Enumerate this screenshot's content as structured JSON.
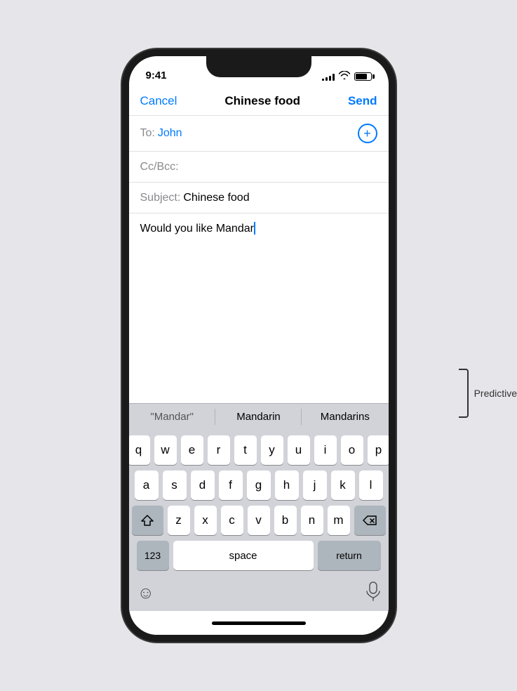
{
  "status": {
    "time": "9:41",
    "signal_bars": [
      3,
      5,
      7,
      9,
      11
    ],
    "battery_level": 80
  },
  "nav": {
    "cancel_label": "Cancel",
    "title": "Chinese food",
    "send_label": "Send"
  },
  "fields": {
    "to_label": "To:",
    "to_value": "John",
    "cc_label": "Cc/Bcc:",
    "subject_label": "Subject:",
    "subject_value": "Chinese food"
  },
  "body": {
    "text": "Would you like Mandar"
  },
  "predictive": {
    "items": [
      {
        "label": "\"Mandar\"",
        "quoted": true
      },
      {
        "label": "Mandarin",
        "quoted": false
      },
      {
        "label": "Mandarins",
        "quoted": false
      }
    ]
  },
  "keyboard": {
    "rows": [
      [
        "q",
        "w",
        "e",
        "r",
        "t",
        "y",
        "u",
        "i",
        "o",
        "p"
      ],
      [
        "a",
        "s",
        "d",
        "f",
        "g",
        "h",
        "j",
        "k",
        "l"
      ],
      [
        "z",
        "x",
        "c",
        "v",
        "b",
        "n",
        "m"
      ]
    ],
    "special": {
      "shift": "⇧",
      "delete": "⌫",
      "numbers": "123",
      "space": "space",
      "return": "return"
    }
  },
  "annotation": {
    "label": "Predictive text"
  }
}
